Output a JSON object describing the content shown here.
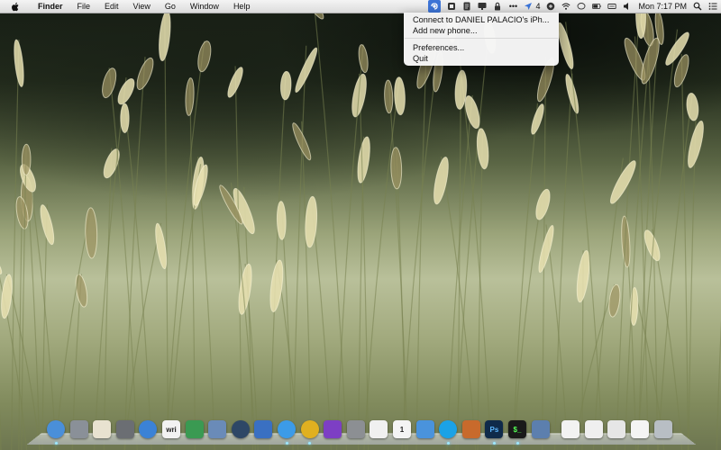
{
  "menubar": {
    "app_name": "Finder",
    "menus": [
      "File",
      "Edit",
      "View",
      "Go",
      "Window",
      "Help"
    ],
    "status": {
      "location_count": "4",
      "clock": "Mon 7:17 PM"
    }
  },
  "dropdown": {
    "items": [
      "Connect to DANIEL PALACIO's iPh...",
      "Add new phone...",
      "Preferences...",
      "Quit"
    ]
  },
  "dock": {
    "apps": [
      {
        "name": "finder-icon",
        "color": "#4a8fd9"
      },
      {
        "name": "rocket-icon",
        "color": "#8a9098"
      },
      {
        "name": "notes-icon",
        "color": "#e8e2d0"
      },
      {
        "name": "photo-viewer-icon",
        "color": "#6b6e73"
      },
      {
        "name": "itunes-icon",
        "color": "#3b82d6"
      },
      {
        "name": "writer-icon",
        "color": "#f2f2f2"
      },
      {
        "name": "pencil-app-icon",
        "color": "#3a9a52"
      },
      {
        "name": "image-editor-icon",
        "color": "#6a8bb8"
      },
      {
        "name": "system-preferences-icon",
        "color": "#2e4766"
      },
      {
        "name": "bird-app-icon",
        "color": "#3a70c2"
      },
      {
        "name": "messages-icon",
        "color": "#3c9be8"
      },
      {
        "name": "chrome-icon",
        "color": "#e0b020"
      },
      {
        "name": "tasks-icon",
        "color": "#7d3fc4"
      },
      {
        "name": "calculator-icon",
        "color": "#8c8f93"
      },
      {
        "name": "text-editor-icon",
        "color": "#f0f0f0"
      },
      {
        "name": "calendar-icon",
        "color": "#f4f4f4"
      },
      {
        "name": "location-app-icon",
        "color": "#4a93dc"
      },
      {
        "name": "skype-icon",
        "color": "#1ba2e6"
      },
      {
        "name": "presentation-icon",
        "color": "#c86a2c"
      },
      {
        "name": "photoshop-icon",
        "color": "#0f2a4a"
      },
      {
        "name": "terminal-icon",
        "color": "#1a1a1a"
      },
      {
        "name": "xcode-icon",
        "color": "#5c7fae"
      },
      {
        "name": "document-icon",
        "color": "#f2f2f2"
      },
      {
        "name": "spreadsheet-icon",
        "color": "#efefef"
      },
      {
        "name": "printer-icon",
        "color": "#e6e6e6"
      },
      {
        "name": "file-icon",
        "color": "#f4f4f4"
      },
      {
        "name": "trash-icon",
        "color": "#b8bec4"
      }
    ],
    "labels": {
      "writer": "wri",
      "calendar": "1",
      "photoshop": "Ps",
      "terminal": "$_"
    }
  }
}
